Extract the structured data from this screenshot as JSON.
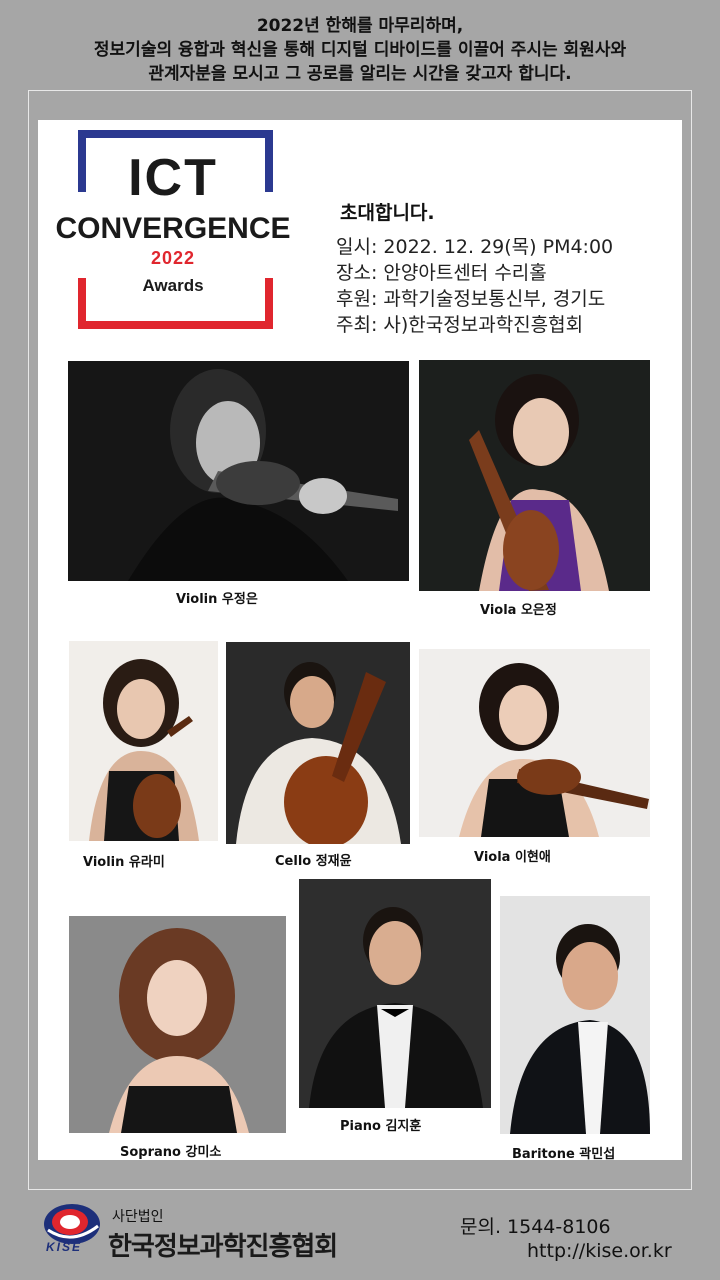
{
  "header": {
    "line1": "2022년 한해를 마무리하며,",
    "line2": "정보기술의 융합과 혁신을 통해 디지털 디바이드를 이끌어 주시는 회원사와",
    "line3": "관계자분을 모시고 그 공로를 알리는 시간을 갖고자 합니다."
  },
  "logo": {
    "ict": "ICT",
    "convergence": "CONVERGENCE",
    "year": "2022",
    "awards": "Awards"
  },
  "invitation": {
    "title": "초대합니다.",
    "date": "일시: 2022. 12. 29(목) PM4:00",
    "venue": "장소: 안양아트센터 수리홀",
    "sponsor": "후원: 과학기술정보통신부, 경기도",
    "host": "주최: 사)한국정보과학진흥협회"
  },
  "performers": [
    {
      "caption": "Violin  우정은"
    },
    {
      "caption": "Viola 오은정"
    },
    {
      "caption": "Violin 유라미"
    },
    {
      "caption": "Cello 정재윤"
    },
    {
      "caption": "Viola  이현애"
    },
    {
      "caption": "Soprano 강미소"
    },
    {
      "caption": "Piano 김지훈"
    },
    {
      "caption": "Baritone 곽민섭"
    }
  ],
  "footer": {
    "kise": "KISE",
    "org_small": "사단법인",
    "org_name": "한국정보과학진흥협회",
    "contact": "문의.   1544-8106",
    "url": "http://kise.or.kr"
  },
  "colors": {
    "background": "#a6a6a6",
    "logo_blue": "#2b3990",
    "logo_red": "#e0262e"
  }
}
